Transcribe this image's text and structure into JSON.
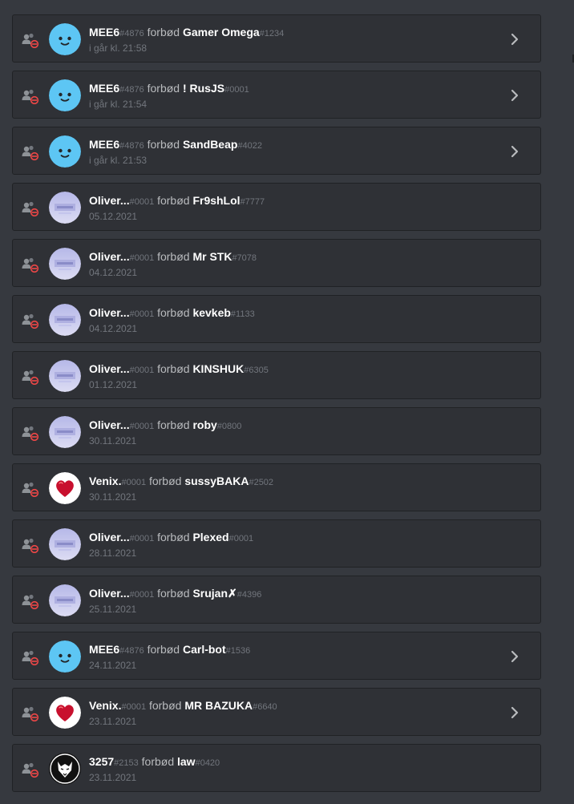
{
  "icons": {
    "entry_type": "member-ban-icon",
    "expand": "chevron-right-icon"
  },
  "colors": {
    "background": "#36393f",
    "card": "#2f3136",
    "ban_icon": "#f04747",
    "mee6_avatar": "#5dc6f4"
  },
  "entries": [
    {
      "actor": "MEE6",
      "actor_tag": "#4876",
      "action": "forbød",
      "target": "Gamer Omega",
      "target_tag": "#1234",
      "time": "i går kl. 21:58",
      "avatar": "mee6",
      "expandable": true
    },
    {
      "actor": "MEE6",
      "actor_tag": "#4876",
      "action": "forbød",
      "target": "! RusJS",
      "target_tag": "#0001",
      "time": "i går kl. 21:54",
      "avatar": "mee6",
      "expandable": true
    },
    {
      "actor": "MEE6",
      "actor_tag": "#4876",
      "action": "forbød",
      "target": "SandBeap",
      "target_tag": "#4022",
      "time": "i går kl. 21:53",
      "avatar": "mee6",
      "expandable": true
    },
    {
      "actor": "Oliver...",
      "actor_tag": "#0001",
      "action": "forbød",
      "target": "Fr9shLol",
      "target_tag": "#7777",
      "time": "05.12.2021",
      "avatar": "oliver",
      "expandable": false
    },
    {
      "actor": "Oliver...",
      "actor_tag": "#0001",
      "action": "forbød",
      "target": "Mr STK",
      "target_tag": "#7078",
      "time": "04.12.2021",
      "avatar": "oliver",
      "expandable": false
    },
    {
      "actor": "Oliver...",
      "actor_tag": "#0001",
      "action": "forbød",
      "target": "kevkeb",
      "target_tag": "#1133",
      "time": "04.12.2021",
      "avatar": "oliver",
      "expandable": false
    },
    {
      "actor": "Oliver...",
      "actor_tag": "#0001",
      "action": "forbød",
      "target": "KINSHUK",
      "target_tag": "#6305",
      "time": "01.12.2021",
      "avatar": "oliver",
      "expandable": false
    },
    {
      "actor": "Oliver...",
      "actor_tag": "#0001",
      "action": "forbød",
      "target": "roby",
      "target_tag": "#0800",
      "time": "30.11.2021",
      "avatar": "oliver",
      "expandable": false
    },
    {
      "actor": "Venix.",
      "actor_tag": "#0001",
      "action": "forbød",
      "target": "sussyBAKA",
      "target_tag": "#2502",
      "time": "30.11.2021",
      "avatar": "heart",
      "expandable": false
    },
    {
      "actor": "Oliver...",
      "actor_tag": "#0001",
      "action": "forbød",
      "target": "Plexed",
      "target_tag": "#0001",
      "time": "28.11.2021",
      "avatar": "oliver",
      "expandable": false
    },
    {
      "actor": "Oliver...",
      "actor_tag": "#0001",
      "action": "forbød",
      "target": "Srujan✗",
      "target_tag": "#4396",
      "time": "25.11.2021",
      "avatar": "oliver",
      "expandable": false
    },
    {
      "actor": "MEE6",
      "actor_tag": "#4876",
      "action": "forbød",
      "target": "Carl-bot",
      "target_tag": "#1536",
      "time": "24.11.2021",
      "avatar": "mee6",
      "expandable": true
    },
    {
      "actor": "Venix.",
      "actor_tag": "#0001",
      "action": "forbød",
      "target": "MR BAZUKA",
      "target_tag": "#6640",
      "time": "23.11.2021",
      "avatar": "heart",
      "expandable": true
    },
    {
      "actor": "3257",
      "actor_tag": "#2153",
      "action": "forbød",
      "target": "law",
      "target_tag": "#0420",
      "time": "23.11.2021",
      "avatar": "wolf",
      "expandable": false
    }
  ]
}
